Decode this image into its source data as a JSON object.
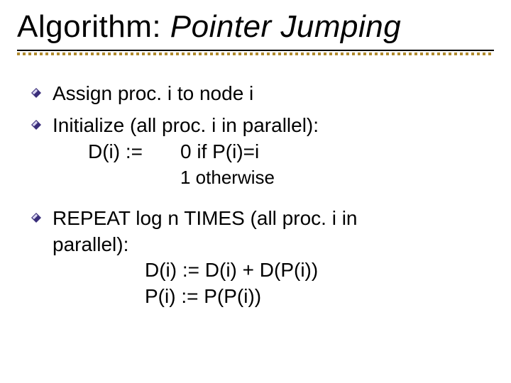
{
  "title": {
    "prefix": "Algorithm: ",
    "emph": "Pointer Jumping"
  },
  "bullets": {
    "b1": "Assign proc. i to node i",
    "b2": "Initialize (all proc. i in parallel):",
    "b2_lhs": "D(i) :=",
    "b2_rhs1": "0 if P(i)=i",
    "b2_rhs2": "1 otherwise",
    "b3_l1": "REPEAT log n TIMES (all proc. i in",
    "b3_l2": "parallel):",
    "b3_s1": "D(i) := D(i) + D(P(i))",
    "b3_s2": "P(i) := P(P(i))"
  },
  "icons": {
    "bullet": "diamond-bullet-icon"
  },
  "colors": {
    "bullet_fill": "#3a2e7a",
    "bullet_glint": "#d8d4f0",
    "accent": "#b08a2e"
  }
}
